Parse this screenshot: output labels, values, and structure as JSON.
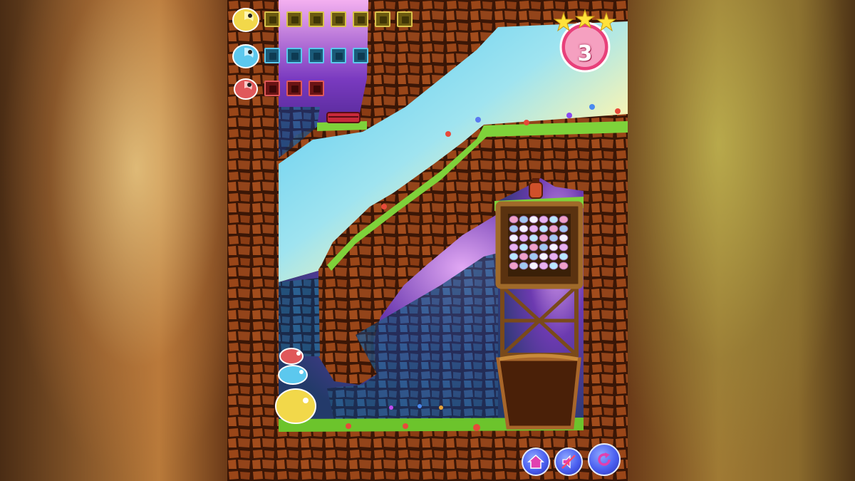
{
  "level": {
    "label": "3",
    "stars_earned": 3,
    "stars_total": 3
  },
  "inventory": [
    {
      "color": "yellow",
      "count": 7,
      "accent": "#d8c24a"
    },
    {
      "color": "blue",
      "count": 5,
      "accent": "#5cc8ee"
    },
    {
      "color": "red",
      "count": 3,
      "accent": "#e0585a"
    }
  ],
  "buttons": {
    "home": "home-icon",
    "sound": "sound-muted-icon",
    "restart": "restart-icon"
  },
  "colors": {
    "rock": "#8a3a16",
    "grass": "#7ed23a",
    "sky": "#6fd0f5",
    "button": "#4a5ff0",
    "badge": "#e8407a"
  }
}
